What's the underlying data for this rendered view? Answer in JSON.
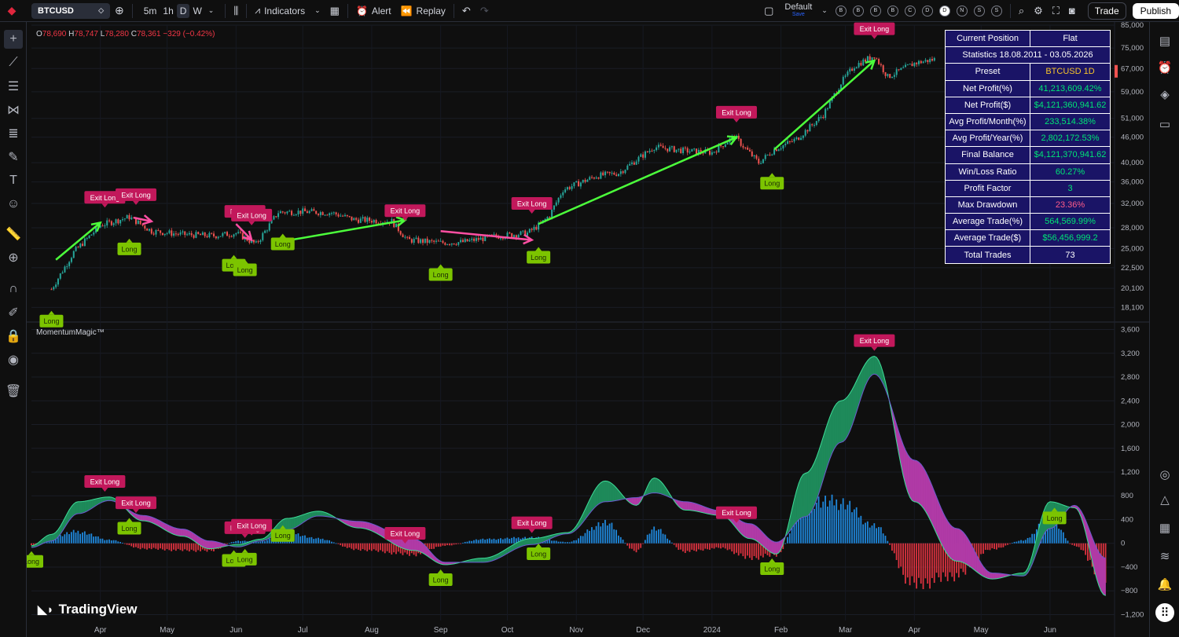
{
  "toolbar": {
    "symbol": "BTCUSD",
    "timeframes": [
      "5m",
      "1h",
      "D",
      "W"
    ],
    "active_timeframe": "D",
    "indicators_label": "Indicators",
    "alert_label": "Alert",
    "replay_label": "Replay",
    "layout_name": "Default",
    "layout_sub": "Save",
    "pills": [
      "B",
      "B",
      "B",
      "B",
      "C",
      "D",
      "D",
      "N",
      "S",
      "S"
    ],
    "active_pill_index": 6,
    "trade_label": "Trade",
    "publish_label": "Publish"
  },
  "legend": {
    "o_label": "O",
    "o": "78,690",
    "h_label": "H",
    "h": "78,747",
    "l_label": "L",
    "l": "78,280",
    "c_label": "C",
    "c": "78,361",
    "change": "−329 (−0.42%)"
  },
  "indicator_name": "MomentumMagic™",
  "brand": "TradingView",
  "stats_table": {
    "position_label": "Current Position",
    "position_value": "Flat",
    "period": "Statistics 18.08.2011 - 03.05.2026",
    "rows": [
      {
        "label": "Preset",
        "value": "BTCUSD 1D",
        "tone": "gold"
      },
      {
        "label": "Net Profit(%)",
        "value": "41,213,609.42%",
        "tone": "pos"
      },
      {
        "label": "Net Profit($)",
        "value": "$4,121,360,941.62",
        "tone": "pos"
      },
      {
        "label": "Avg Profit/Month(%)",
        "value": "233,514.38%",
        "tone": "pos"
      },
      {
        "label": "Avg Profit/Year(%)",
        "value": "2,802,172.53%",
        "tone": "pos"
      },
      {
        "label": "Final Balance",
        "value": "$4,121,370,941.62",
        "tone": "pos"
      },
      {
        "label": "Win/Loss Ratio",
        "value": "60.27%",
        "tone": "pos"
      },
      {
        "label": "Profit Factor",
        "value": "3",
        "tone": "pos"
      },
      {
        "label": "Max Drawdown",
        "value": "23.36%",
        "tone": "neg"
      },
      {
        "label": "Average Trade(%)",
        "value": "564,569.99%",
        "tone": "pos"
      },
      {
        "label": "Average Trade($)",
        "value": "$56,456,999.2",
        "tone": "pos"
      },
      {
        "label": "Total Trades",
        "value": "73",
        "tone": "wt"
      }
    ]
  },
  "colors": {
    "up": "#26a69a",
    "down": "#ef5350",
    "long": "#7cc400",
    "exit": "#c2185b",
    "arrow_up": "#4cff3b",
    "arrow_flat": "#ff4fa3",
    "fill_bull": "#1e8a5a",
    "fill_bear": "#b03aa6",
    "hist_pos": "#2196f3",
    "hist_neg": "#f23645"
  },
  "chart_data": [
    {
      "type": "candlestick",
      "yscale": "log",
      "ylim": [
        17000,
        85000
      ],
      "y_ticks": [
        18100,
        20100,
        22500,
        25000,
        28000,
        32000,
        36000,
        40000,
        46000,
        51000,
        59000,
        67000,
        75000,
        85000
      ],
      "y_tick_labels": [
        "18,100",
        "20,100",
        "22,500",
        "25,000",
        "28,000",
        "32,000",
        "36,000",
        "40,000",
        "46,000",
        "51,000",
        "59,000",
        "67,000",
        "75,000",
        "85,000"
      ],
      "x_ticks": [
        "Apr",
        "May",
        "Jun",
        "Jul",
        "Aug",
        "Sep",
        "Oct",
        "Nov",
        "Dec",
        "2024",
        "Feb",
        "Mar",
        "Apr",
        "May",
        "Jun"
      ],
      "x": [
        "2023-03-10",
        "2023-03-20",
        "2023-04-01",
        "2023-04-14",
        "2023-04-24",
        "2023-05-08",
        "2023-05-22",
        "2023-06-01",
        "2023-06-10",
        "2023-06-20",
        "2023-07-01",
        "2023-07-14",
        "2023-07-24",
        "2023-08-10",
        "2023-08-17",
        "2023-09-01",
        "2023-09-11",
        "2023-09-25",
        "2023-10-10",
        "2023-10-16",
        "2023-10-20",
        "2023-10-26",
        "2023-11-10",
        "2023-11-20",
        "2023-12-06",
        "2023-12-20",
        "2024-01-01",
        "2024-01-11",
        "2024-01-22",
        "2024-01-29",
        "2024-02-08",
        "2024-02-20",
        "2024-02-28",
        "2024-03-05",
        "2024-03-14",
        "2024-03-20",
        "2024-04-01",
        "2024-04-10"
      ],
      "close": [
        20000,
        24500,
        28400,
        29700,
        27500,
        27000,
        26800,
        27200,
        25600,
        30500,
        30600,
        30400,
        29300,
        29000,
        26200,
        25800,
        25900,
        26700,
        27200,
        28600,
        30000,
        34500,
        37200,
        37800,
        43600,
        42700,
        42300,
        46200,
        40000,
        43000,
        45500,
        52000,
        62000,
        68000,
        72000,
        64000,
        69000,
        70500
      ],
      "markers": [
        {
          "type": "long",
          "label": "Long",
          "x": "2023-03-10"
        },
        {
          "type": "exit",
          "label": "Exit Long",
          "x": "2023-04-03"
        },
        {
          "type": "exit",
          "label": "Exit Long",
          "x": "2023-04-17"
        },
        {
          "type": "long",
          "label": "Long",
          "x": "2023-04-14"
        },
        {
          "type": "long",
          "label": "Long",
          "x": "2023-05-31"
        },
        {
          "type": "exit",
          "label": "Exit Long",
          "x": "2023-06-05"
        },
        {
          "type": "exit",
          "label": "Exit Long",
          "x": "2023-06-08"
        },
        {
          "type": "long",
          "label": "Long",
          "x": "2023-06-05"
        },
        {
          "type": "long",
          "label": "Long",
          "x": "2023-06-22"
        },
        {
          "type": "exit",
          "label": "Exit Long",
          "x": "2023-08-16"
        },
        {
          "type": "long",
          "label": "Long",
          "x": "2023-09-01"
        },
        {
          "type": "exit",
          "label": "Exit Long",
          "x": "2023-10-12"
        },
        {
          "type": "long",
          "label": "Long",
          "x": "2023-10-15"
        },
        {
          "type": "exit",
          "label": "Exit Long",
          "x": "2024-01-12"
        },
        {
          "type": "long",
          "label": "Long",
          "x": "2024-01-28"
        },
        {
          "type": "exit",
          "label": "Exit Long",
          "x": "2024-03-14"
        }
      ]
    },
    {
      "type": "histogram+area",
      "name": "MomentumMagic™",
      "ylim": [
        -1300,
        3700
      ],
      "y_ticks": [
        3600,
        3200,
        2800,
        2400,
        2000,
        1600,
        1200,
        800,
        400,
        0,
        -400,
        -800,
        -1200
      ],
      "y_tick_labels": [
        "3,600",
        "3,200",
        "2,800",
        "2,400",
        "2,000",
        "1,600",
        "1,200",
        "800",
        "400",
        "0",
        "−400",
        "−800",
        "−1,200"
      ],
      "x": [
        "2023-03-01",
        "2023-03-10",
        "2023-03-22",
        "2023-04-05",
        "2023-04-20",
        "2023-05-08",
        "2023-05-20",
        "2023-06-02",
        "2023-06-12",
        "2023-06-24",
        "2023-07-08",
        "2023-07-26",
        "2023-08-20",
        "2023-09-03",
        "2023-09-20",
        "2023-10-12",
        "2023-10-28",
        "2023-11-14",
        "2023-11-28",
        "2023-12-06",
        "2023-12-20",
        "2024-01-05",
        "2024-01-18",
        "2024-01-30",
        "2024-02-12",
        "2024-02-28",
        "2024-03-14",
        "2024-04-01",
        "2024-04-20",
        "2024-05-06",
        "2024-05-20",
        "2024-06-01",
        "2024-06-12",
        "2024-06-26"
      ],
      "fast": [
        -40,
        150,
        700,
        780,
        380,
        120,
        -90,
        -20,
        70,
        420,
        540,
        260,
        -120,
        -360,
        -250,
        80,
        180,
        1050,
        640,
        1100,
        560,
        470,
        80,
        -180,
        1180,
        2400,
        3150,
        700,
        -300,
        -600,
        -500,
        700,
        600,
        -880
      ],
      "slow": [
        -70,
        40,
        500,
        720,
        470,
        240,
        40,
        -60,
        40,
        230,
        460,
        370,
        70,
        -320,
        -320,
        -20,
        160,
        700,
        770,
        850,
        700,
        550,
        330,
        20,
        450,
        1700,
        2850,
        1400,
        250,
        -500,
        -550,
        250,
        640,
        -250
      ],
      "hist": [
        -40,
        110,
        200,
        60,
        -90,
        -120,
        -130,
        40,
        30,
        190,
        80,
        -110,
        -190,
        -40,
        70,
        100,
        20,
        350,
        -130,
        250,
        -140,
        -80,
        -250,
        -200,
        730,
        700,
        300,
        -700,
        -550,
        -100,
        50,
        450,
        -40,
        -630
      ],
      "markers": [
        {
          "type": "long",
          "label": "Long",
          "x": "2023-03-01"
        },
        {
          "type": "exit",
          "label": "Exit Long",
          "x": "2023-04-03"
        },
        {
          "type": "exit",
          "label": "Exit Long",
          "x": "2023-04-17"
        },
        {
          "type": "long",
          "label": "Long",
          "x": "2023-04-14"
        },
        {
          "type": "long",
          "label": "Long",
          "x": "2023-05-31"
        },
        {
          "type": "exit",
          "label": "Exit Long",
          "x": "2023-06-05"
        },
        {
          "type": "exit",
          "label": "Exit Long",
          "x": "2023-06-08"
        },
        {
          "type": "long",
          "label": "Long",
          "x": "2023-06-05"
        },
        {
          "type": "long",
          "label": "Long",
          "x": "2023-06-22"
        },
        {
          "type": "exit",
          "label": "Exit Long",
          "x": "2023-08-16"
        },
        {
          "type": "long",
          "label": "Long",
          "x": "2023-09-01"
        },
        {
          "type": "exit",
          "label": "Exit Long",
          "x": "2023-10-12"
        },
        {
          "type": "long",
          "label": "Long",
          "x": "2023-10-15"
        },
        {
          "type": "exit",
          "label": "Exit Long",
          "x": "2024-01-12"
        },
        {
          "type": "long",
          "label": "Long",
          "x": "2024-01-28"
        },
        {
          "type": "exit",
          "label": "Exit Long",
          "x": "2024-03-14"
        },
        {
          "type": "long",
          "label": "Long",
          "x": "2024-06-03"
        }
      ]
    }
  ]
}
